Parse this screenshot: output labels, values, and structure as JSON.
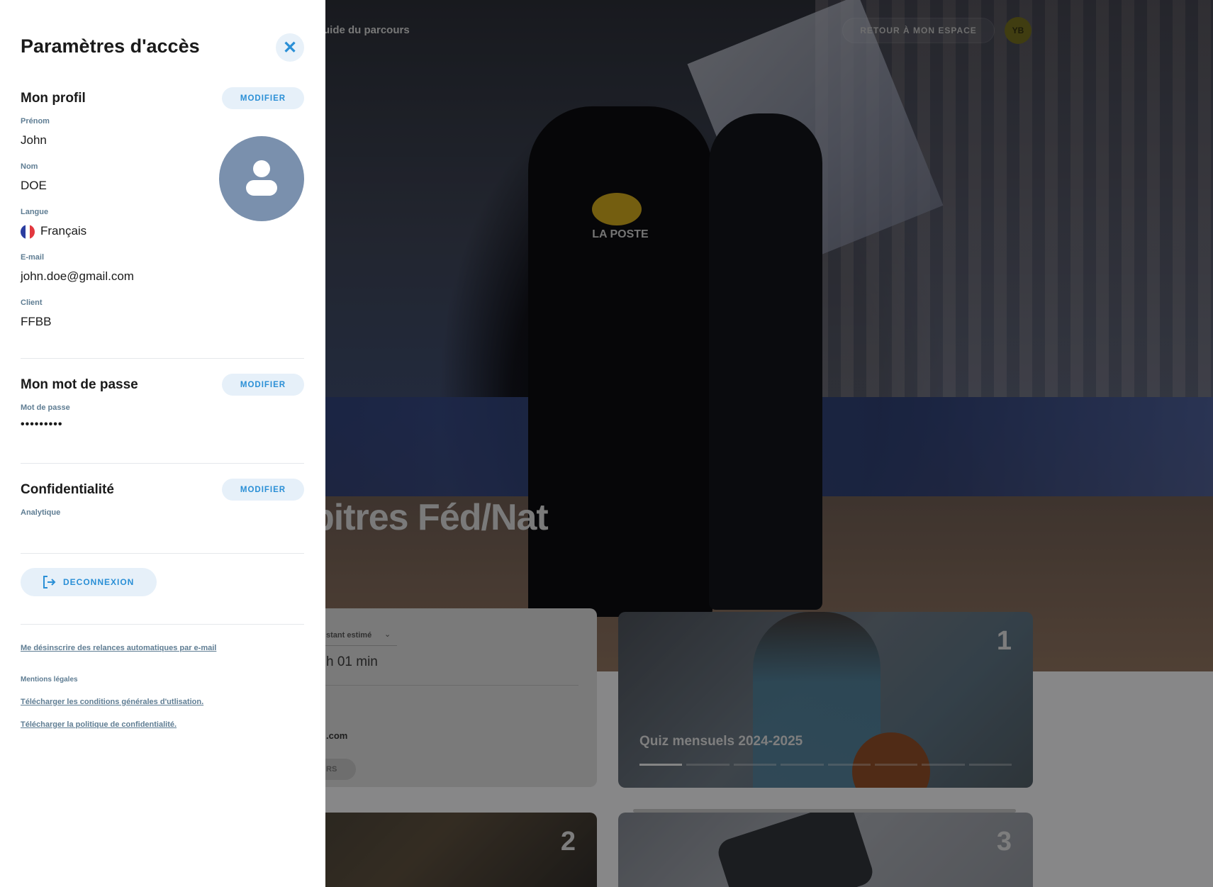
{
  "background": {
    "nav_link": "uide du parcours",
    "back_button": "RETOUR À MON ESPACE",
    "user_initials": "YB",
    "hero_title": "bitres Féd/Nat",
    "jersey_text": "LA POSTE",
    "info_card": {
      "remaining_label": "stant estimé",
      "remaining_value": "h 01 min",
      "email_tail": ".com",
      "button_tail": "RS"
    },
    "cards": [
      {
        "number": "1",
        "title": "Quiz mensuels 2024-2025",
        "segments": 8,
        "active_segment": 1
      },
      {
        "number": "2"
      },
      {
        "number": "3"
      }
    ]
  },
  "panel": {
    "title": "Paramètres d'accès",
    "close_icon": "close-icon",
    "profile": {
      "title": "Mon profil",
      "edit_label": "MODIFIER",
      "fields": {
        "firstname_label": "Prénom",
        "firstname_value": "John",
        "lastname_label": "Nom",
        "lastname_value": "DOE",
        "language_label": "Langue",
        "language_value": "Français",
        "email_label": "E-mail",
        "email_value": "john.doe@gmail.com",
        "client_label": "Client",
        "client_value": "FFBB"
      },
      "avatar_color": "#7a90ad"
    },
    "password": {
      "title": "Mon mot de passe",
      "edit_label": "MODIFIER",
      "field_label": "Mot de passe",
      "field_value": "•••••••••"
    },
    "privacy": {
      "title": "Confidentialité",
      "edit_label": "MODIFIER",
      "field_label": "Analytique"
    },
    "logout_label": "DECONNEXION",
    "links": {
      "unsubscribe": "Me désinscrire des relances automatiques par e-mail",
      "legal_label": "Mentions légales",
      "terms": "Télécharger les conditions générales d'utlisation.",
      "privacy_policy": "Télécharger la politique de confidentialité."
    },
    "accent_color": "#2a8fd6"
  }
}
